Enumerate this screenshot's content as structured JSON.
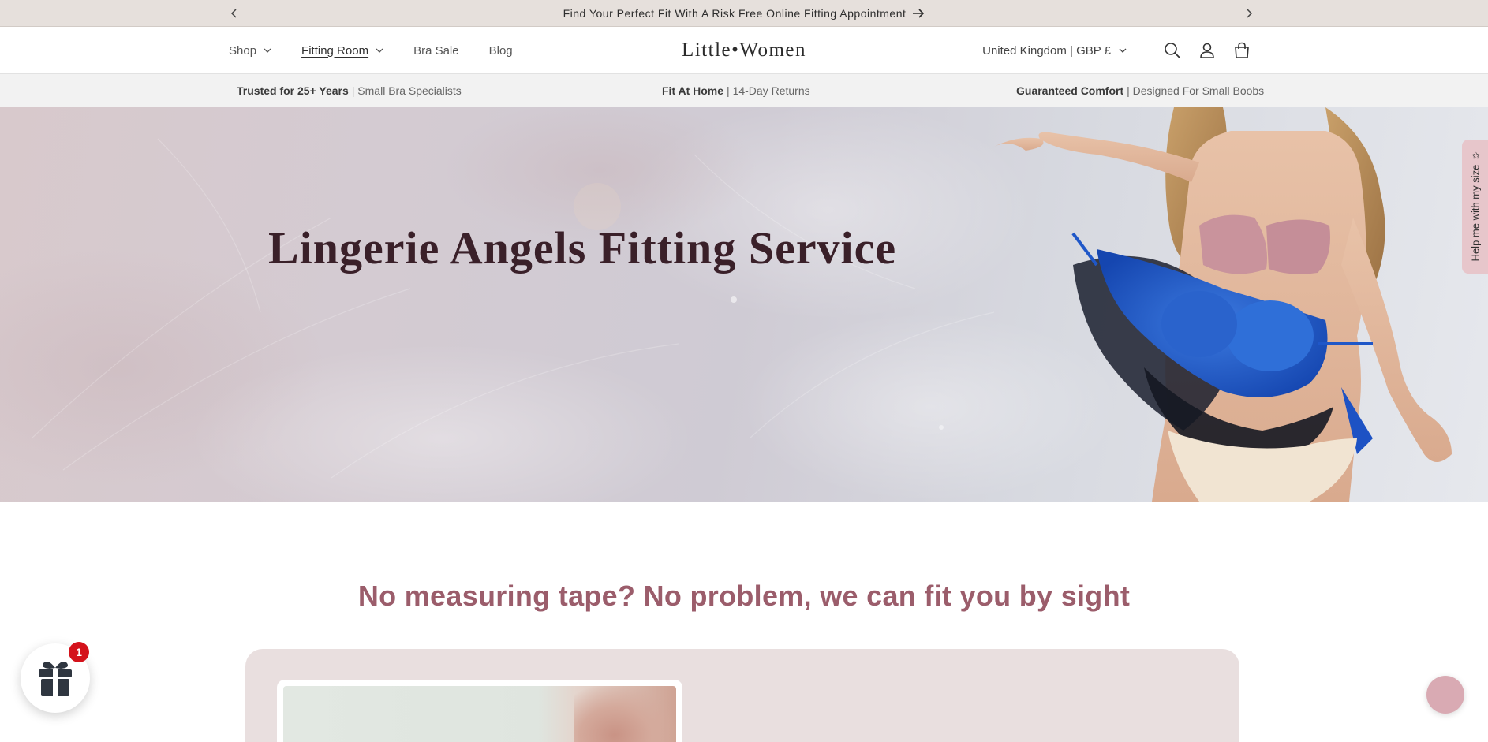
{
  "announcement": {
    "message": "Find Your Perfect Fit With A Risk Free Online Fitting Appointment",
    "prev_icon": "chevron-left-icon",
    "next_icon": "chevron-right-icon",
    "arrow_icon": "arrow-right-icon"
  },
  "header": {
    "nav": [
      {
        "label": "Shop",
        "has_dropdown": true
      },
      {
        "label": "Fitting Room",
        "has_dropdown": true,
        "active": true
      },
      {
        "label": "Bra Sale",
        "has_dropdown": false
      },
      {
        "label": "Blog",
        "has_dropdown": false
      }
    ],
    "logo": "Little•Women",
    "locale": "United Kingdom | GBP £",
    "icons": [
      "search-icon",
      "account-icon",
      "cart-icon"
    ]
  },
  "trust_bar": [
    {
      "bold": "Trusted for 25+ Years",
      "rest": "| Small Bra Specialists"
    },
    {
      "bold": "Fit At Home",
      "rest": "| 14-Day Returns"
    },
    {
      "bold": "Guaranteed Comfort",
      "rest": "| Designed For Small Boobs"
    }
  ],
  "hero": {
    "title": "Lingerie Angels Fitting Service"
  },
  "size_tab": {
    "label": "Help me with my size",
    "icon": "star-icon"
  },
  "section": {
    "heading": "No measuring tape? No problem, we can fit you by sight"
  },
  "gift": {
    "badge": "1",
    "icon": "gift-icon"
  },
  "chat": {
    "icon": "chat-bubble-icon"
  },
  "colors": {
    "announcement_bg": "#e6e0dc",
    "trust_bg": "#f2f2f2",
    "hero_title": "#3a2029",
    "heading_accent": "#9b5d6b",
    "card_bg": "#e9dfdf",
    "size_tab_bg": "#e7c6cb",
    "badge_red": "#d4121b",
    "chat_pink": "#d9aab3"
  }
}
